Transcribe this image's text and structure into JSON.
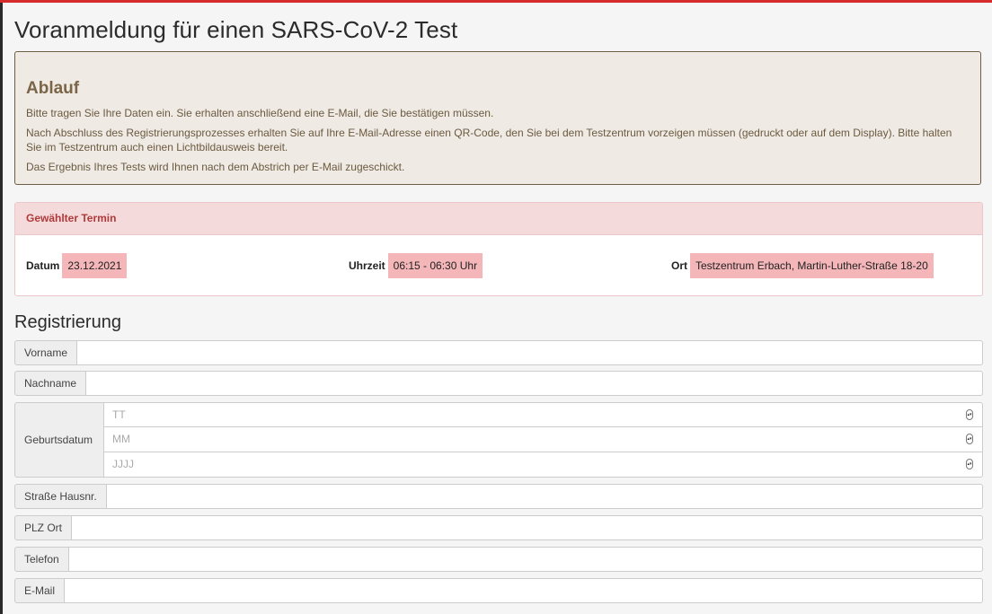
{
  "page": {
    "title": "Voranmeldung für einen SARS-CoV-2 Test"
  },
  "info": {
    "heading": "Ablauf",
    "paragraphs": [
      "Bitte tragen Sie Ihre Daten ein. Sie erhalten anschließend eine E-Mail, die Sie bestätigen müssen.",
      "Nach Abschluss des Registrierungsprozesses erhalten Sie auf Ihre E-Mail-Adresse einen QR-Code, den Sie bei dem Testzentrum vorzeigen müssen (gedruckt oder auf dem Display). Bitte halten Sie im Testzentrum auch einen Lichtbildausweis bereit.",
      "Das Ergebnis Ihres Tests wird Ihnen nach dem Abstrich per E-Mail zugeschickt."
    ]
  },
  "appointment": {
    "header": "Gewählter Termin",
    "date_label": "Datum",
    "date_value": "23.12.2021",
    "time_label": "Uhrzeit",
    "time_value": "06:15 - 06:30 Uhr",
    "place_label": "Ort",
    "place_value": "Testzentrum Erbach, Martin-Luther-Straße 18-20"
  },
  "registration": {
    "title": "Registrierung",
    "firstname_label": "Vorname",
    "firstname_value": "",
    "lastname_label": "Nachname",
    "lastname_value": "",
    "dob_label": "Geburtsdatum",
    "dob_day_placeholder": "TT",
    "dob_month_placeholder": "MM",
    "dob_year_placeholder": "JJJJ",
    "street_label": "Straße Hausnr.",
    "street_value": "",
    "city_label": "PLZ Ort",
    "city_value": "",
    "phone_label": "Telefon",
    "phone_value": "",
    "email_label": "E-Mail",
    "email_value": ""
  },
  "colors": {
    "accent_top": "#d62b2b",
    "info_background": "#efeae3",
    "highlight": "#f4b6b8"
  }
}
